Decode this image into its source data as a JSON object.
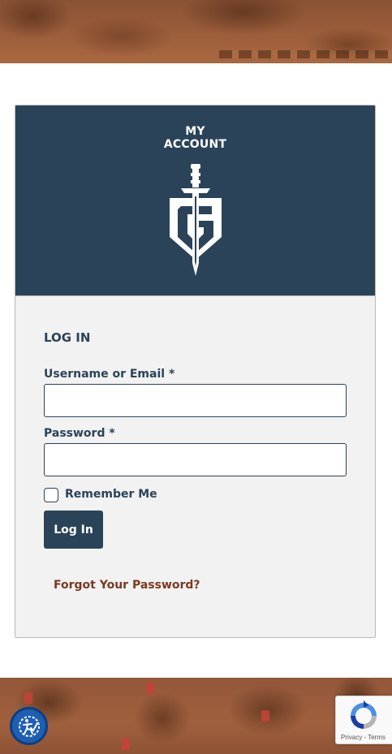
{
  "header": {
    "title_line1": "MY",
    "title_line2": "ACCOUNT"
  },
  "login": {
    "section_title": "LOG IN",
    "username_label": "Username or Email *",
    "username_value": "",
    "password_label": "Password *",
    "password_value": "",
    "remember_label": "Remember Me",
    "remember_checked": false,
    "submit_label": "Log In",
    "forgot_label": "Forgot Your Password?"
  },
  "widgets": {
    "recaptcha_text": "Privacy - Terms",
    "accessibility_icon": "accessibility-icon"
  },
  "colors": {
    "navy": "#2b4358",
    "link_brown": "#7a3a1f",
    "card_bg": "#f2f2f2",
    "accessibility_blue": "#1e5fb3"
  }
}
